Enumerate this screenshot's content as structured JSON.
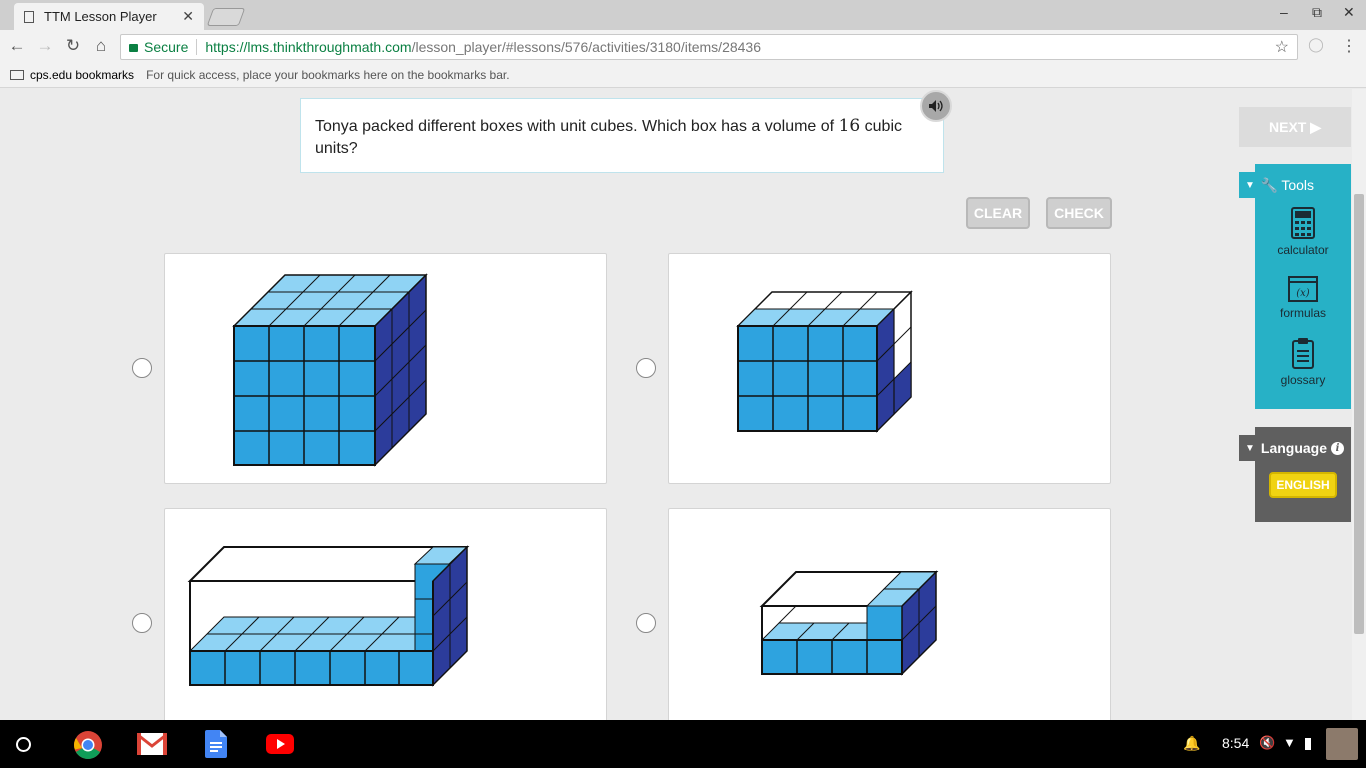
{
  "browser": {
    "tab_title": "TTM Lesson Player",
    "tab_close": "✕",
    "secure_label": "Secure",
    "url_scheme_host": "https://lms.thinkthroughmath.com",
    "url_path": "/lesson_player/#lessons/576/activities/3180/items/28436",
    "bookmarks_folder": "cps.edu bookmarks",
    "bookmarks_hint": "For quick access, place your bookmarks here on the bookmarks bar."
  },
  "question": {
    "text_before": "Tonya packed different boxes with unit cubes. Which box has a volume of ",
    "number": "16",
    "text_after": " cubic units?"
  },
  "actions": {
    "clear_label": "CLEAR",
    "check_label": "CHECK",
    "next_label": "NEXT ▶"
  },
  "tools": {
    "title": "Tools",
    "items": [
      {
        "label": "calculator",
        "icon": "calculator-icon"
      },
      {
        "label": "formulas",
        "icon": "formulas-icon"
      },
      {
        "label": "glossary",
        "icon": "glossary-icon"
      }
    ]
  },
  "language": {
    "title": "Language",
    "selected": "ENGLISH"
  },
  "system": {
    "time": "8:54"
  },
  "colors": {
    "cube_front": "#2ea3df",
    "cube_top": "#8fd3f4",
    "cube_side": "#2c3c9b",
    "tools_panel": "#27b1c6",
    "language_panel": "#5f5f5f",
    "english_button": "#f0d312"
  }
}
